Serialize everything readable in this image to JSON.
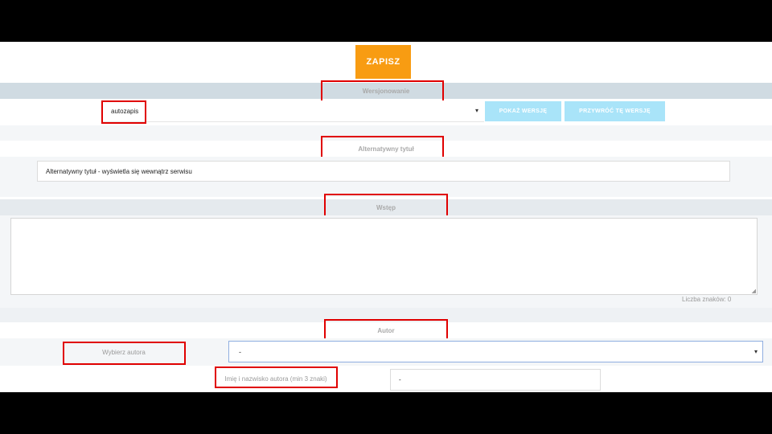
{
  "toolbar": {
    "save_label": "ZAPISZ"
  },
  "versioning": {
    "title": "Wersjonowanie",
    "selected": "autozapis",
    "arrow": "▾",
    "show_version_label": "POKAŻ WERSJĘ",
    "restore_version_label": "PRZYWRÓĆ TĘ WERSJĘ"
  },
  "alt_title": {
    "title": "Alternatywny tytuł",
    "value": "Alternatywny tytuł - wyświetla się wewnątrz serwisu"
  },
  "intro": {
    "title": "Wstęp",
    "value": "",
    "char_count_label": "Liczba znaków: 0"
  },
  "author": {
    "title": "Autor",
    "choose_label": "Wybierz autora",
    "choose_value": "-",
    "arrow": "▾",
    "name_label": "Imię i nazwisko autora (min 3 znaki)",
    "name_value": "-"
  },
  "colors": {
    "save_button": "#f89c12",
    "light_button": "#a9e4f9",
    "highlight_border": "#e00000"
  }
}
